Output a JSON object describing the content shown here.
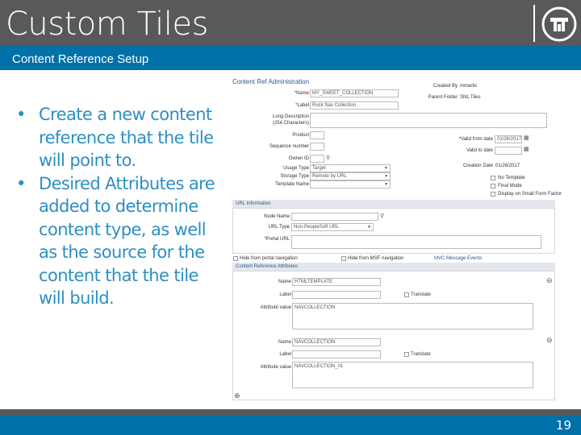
{
  "slide": {
    "title": "Custom Tiles",
    "subtitle": "Content Reference Setup",
    "bullets": [
      "Create a new content reference that the tile will point to.",
      "Desired Attributes are added to determine content type, as well as the source for the content that the tile will build."
    ],
    "page_number": "19"
  },
  "colors": {
    "title_bar": "#595959",
    "accent_blue": "#0070a8",
    "bullet_text": "#2c8fc3"
  },
  "screenshot": {
    "heading": "Content Ref Administration",
    "name_label": "*Name",
    "name_value": "MY_SWEET_COLLECTION",
    "label_label": "*Label",
    "label_value": "Ruck Nav Collection",
    "long_desc_label": "Long Description",
    "long_desc_chars": "(254 Characters)",
    "product_label": "Product",
    "sequence_label": "Sequence number",
    "owner_label": "Owner ID",
    "usage_type_label": "Usage Type",
    "usage_type_value": "Target",
    "storage_type_label": "Storage Type",
    "storage_type_value": "Remote by URL",
    "template_name_label": "Template Name",
    "created_by_label": "Created By",
    "created_by_value": "mmartic",
    "parent_folder_label": "Parent Folder",
    "parent_folder_value": "SNL Tiles",
    "valid_from_label": "*Valid from date",
    "valid_from_value": "01/26/2017",
    "valid_to_label": "Valid to date",
    "creation_date_label": "Creation Date",
    "creation_date_value": "01/26/2017",
    "no_template_label": "No Template",
    "final_mode_label": "Final Mode",
    "display_small_label": "Display on Small Form Factor",
    "url_info_header": "URL Information",
    "node_name_label": "Node Name",
    "url_type_label": "URL Type",
    "url_type_value": "Non-PeopleSoft URL",
    "portal_url_label": "*Portal URL",
    "hide_portal_label": "Hide from portal navigation",
    "hide_mdf_label": "Hide from MSF navigation",
    "mvc_link": "MVC Message Events",
    "attrs_header": "Content Reference Attributes",
    "attr_name_label": "Name",
    "attr1_name": "HTMLTEMPLATE",
    "attr_label_label": "Label",
    "translate_label": "Translate",
    "attr_value_label": "Attribute value",
    "attr1_value": "NAVCOLLECTION",
    "attr2_name": "NAVCOLLECTION",
    "attr2_value": "NAVCOLLECTION_01"
  }
}
